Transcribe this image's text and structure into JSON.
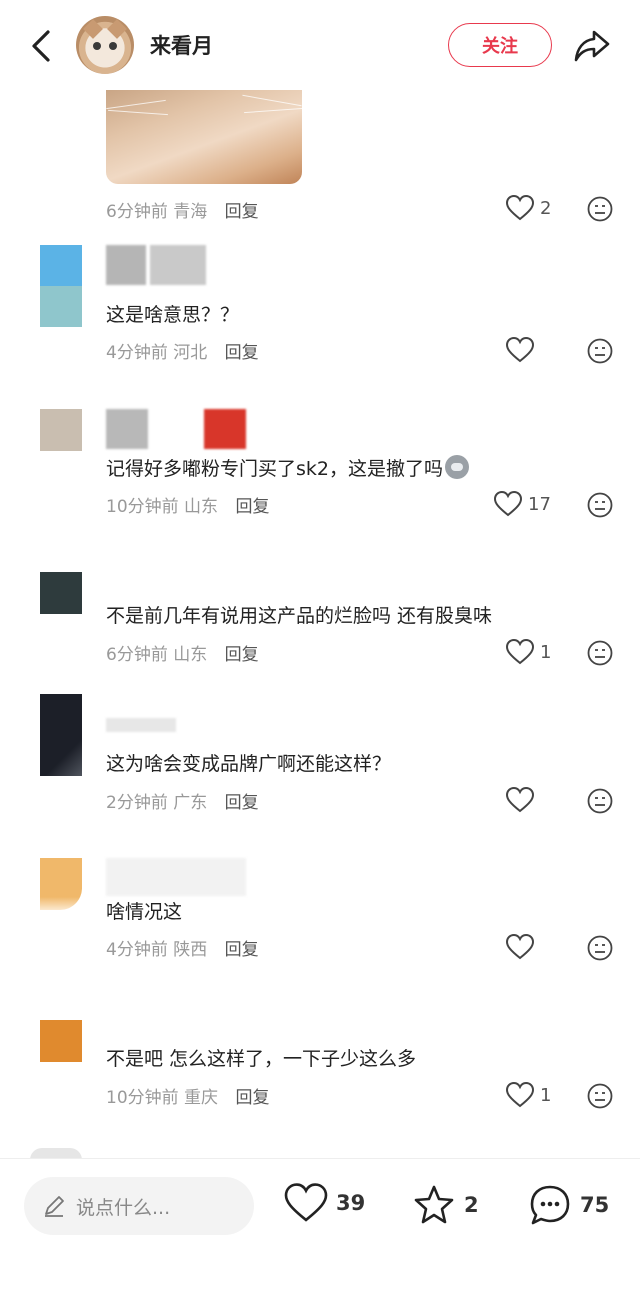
{
  "header": {
    "username": "来看月",
    "follow_label": "关注"
  },
  "comments": [
    {
      "time": "6分钟前",
      "location": "青海",
      "reply": "回复",
      "likes": "2",
      "text": ""
    },
    {
      "time": "4分钟前",
      "location": "河北",
      "reply": "回复",
      "likes": "",
      "text": "这是啥意思？？"
    },
    {
      "time": "10分钟前",
      "location": "山东",
      "reply": "回复",
      "likes": "17",
      "text": "记得好多嘟粉专门买了sk2，这是撤了吗"
    },
    {
      "time": "6分钟前",
      "location": "山东",
      "reply": "回复",
      "likes": "1",
      "text": "不是前几年有说用这产品的烂脸吗 还有股臭味"
    },
    {
      "time": "2分钟前",
      "location": "广东",
      "reply": "回复",
      "likes": "",
      "text": "这为啥会变成品牌广啊还能这样？"
    },
    {
      "time": "4分钟前",
      "location": "陕西",
      "reply": "回复",
      "likes": "",
      "text": "啥情况这"
    },
    {
      "time": "10分钟前",
      "location": "重庆",
      "reply": "回复",
      "likes": "1",
      "text": "不是吧 怎么这样了，一下子少这么多"
    }
  ],
  "bottom_bar": {
    "input_placeholder": "说点什么...",
    "likes_count": "39",
    "favorites_count": "2",
    "comments_count": "75"
  },
  "colors": {
    "accent_red": "#e8394d",
    "meta_gray": "#999999",
    "text": "#222222"
  },
  "icons": [
    "back-arrow-icon",
    "share-icon",
    "heart-icon",
    "emoji-icon",
    "pencil-icon",
    "star-icon",
    "comment-bubble-icon"
  ]
}
